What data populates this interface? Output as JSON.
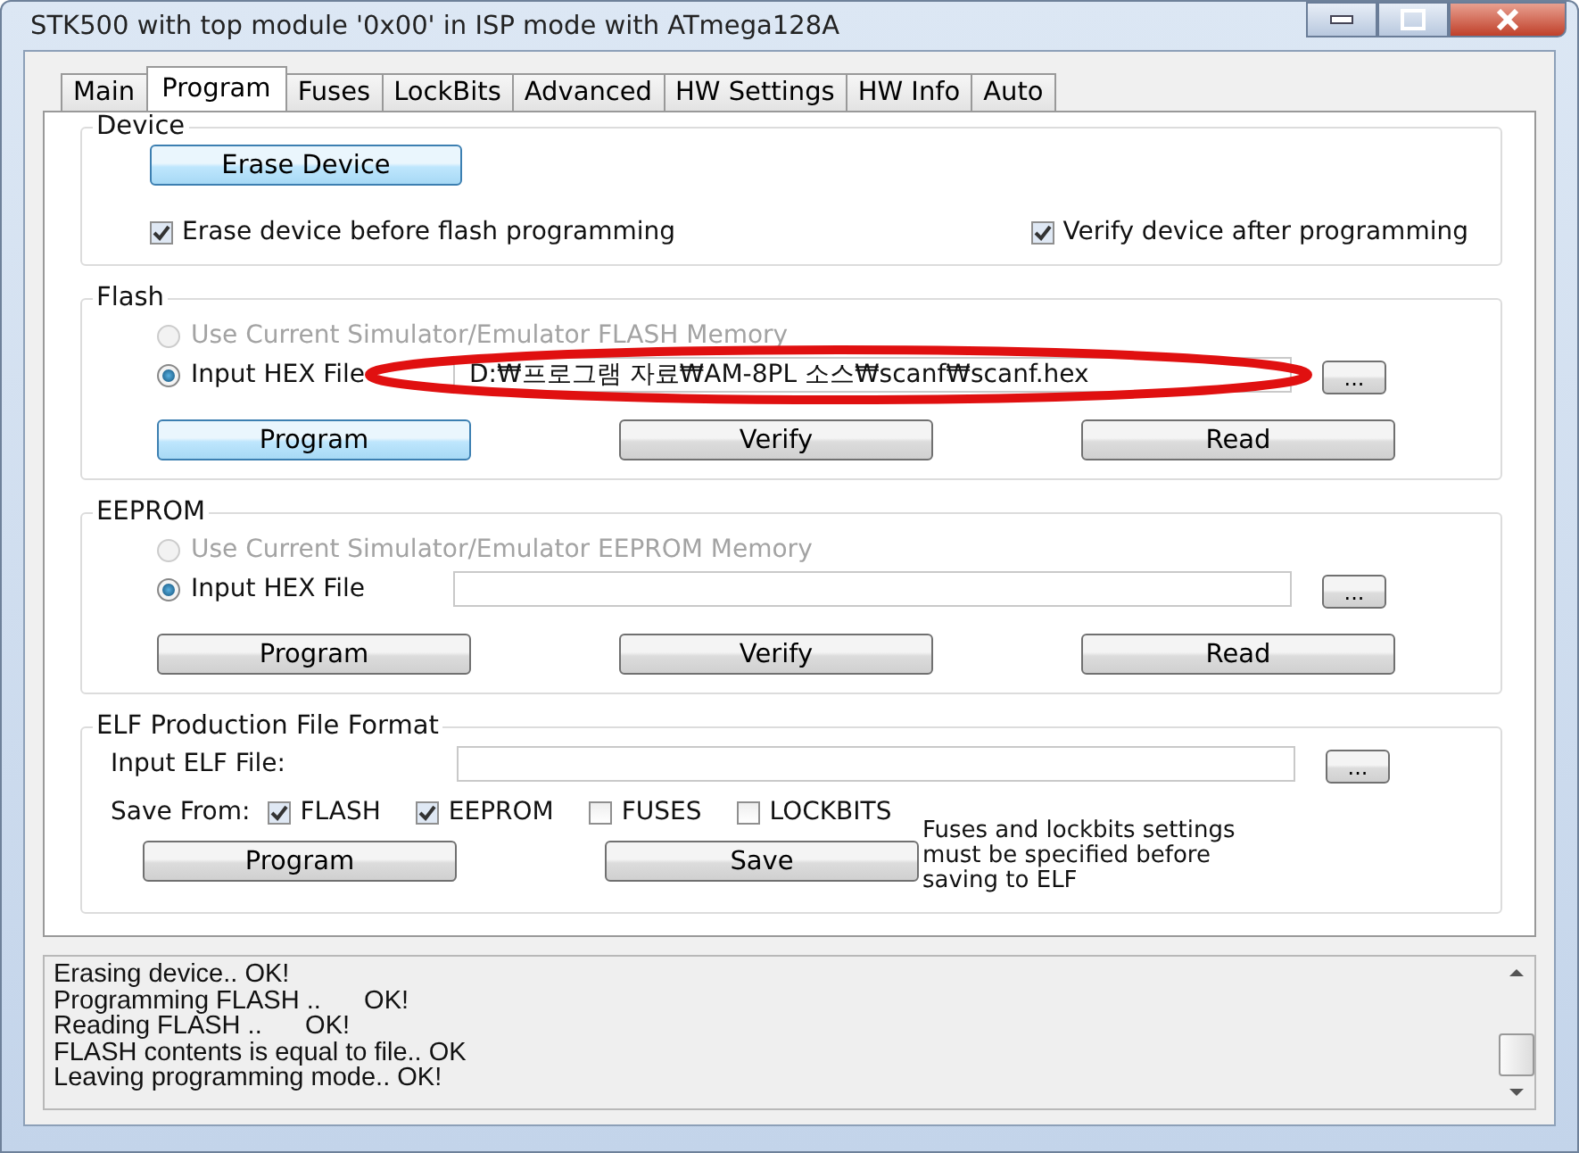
{
  "window": {
    "title": "STK500 with top module '0x00' in ISP mode with ATmega128A"
  },
  "tabs": [
    {
      "label": "Main",
      "selected": false
    },
    {
      "label": "Program",
      "selected": true
    },
    {
      "label": "Fuses",
      "selected": false
    },
    {
      "label": "LockBits",
      "selected": false
    },
    {
      "label": "Advanced",
      "selected": false
    },
    {
      "label": "HW Settings",
      "selected": false
    },
    {
      "label": "HW Info",
      "selected": false
    },
    {
      "label": "Auto",
      "selected": false
    }
  ],
  "device": {
    "title": "Device",
    "button": {
      "label": "Erase Device",
      "focused": true
    },
    "checkboxes": [
      {
        "label": "Erase device before flash programming",
        "checked": true
      },
      {
        "label": "Verify device after programming",
        "checked": true
      }
    ]
  },
  "memories": [
    {
      "title": "Flash",
      "options": [
        {
          "label": "Use Current Simulator/Emulator FLASH Memory",
          "selected": false,
          "disabled": true
        },
        {
          "label": "Input HEX File",
          "selected": true,
          "disabled": false
        }
      ],
      "file": "D:₩프로그램 자료₩AM-8PL 소스₩scanf₩scanf.hex",
      "browse": "...",
      "buttons": [
        {
          "label": "Program",
          "focused": true
        },
        {
          "label": "Verify",
          "focused": false
        },
        {
          "label": "Read",
          "focused": false
        }
      ]
    },
    {
      "title": "EEPROM",
      "options": [
        {
          "label": "Use Current Simulator/Emulator EEPROM Memory",
          "selected": false,
          "disabled": true
        },
        {
          "label": "Input HEX File",
          "selected": true,
          "disabled": false
        }
      ],
      "browse": "...",
      "buttons": [
        {
          "label": "Program",
          "focused": false
        },
        {
          "label": "Verify",
          "focused": false
        },
        {
          "label": "Read",
          "focused": false
        }
      ]
    }
  ],
  "elf": {
    "title": "ELF Production File Format",
    "input_label": "Input ELF File:",
    "browse": "...",
    "save_from": "Save From:",
    "checkboxes": [
      {
        "label": "FLASH",
        "checked": true
      },
      {
        "label": "EEPROM",
        "checked": true
      },
      {
        "label": "FUSES",
        "checked": false
      },
      {
        "label": "LOCKBITS",
        "checked": false
      }
    ],
    "note": "Fuses and lockbits settings must be specified before saving to ELF",
    "buttons": [
      {
        "label": "Program",
        "focused": false
      },
      {
        "label": "Save",
        "focused": false
      }
    ]
  },
  "log": [
    "Erasing device.. OK!",
    "Programming FLASH ..      OK!",
    "Reading FLASH ..      OK!",
    "FLASH contents is equal to file.. OK",
    "Leaving programming mode.. OK!"
  ]
}
